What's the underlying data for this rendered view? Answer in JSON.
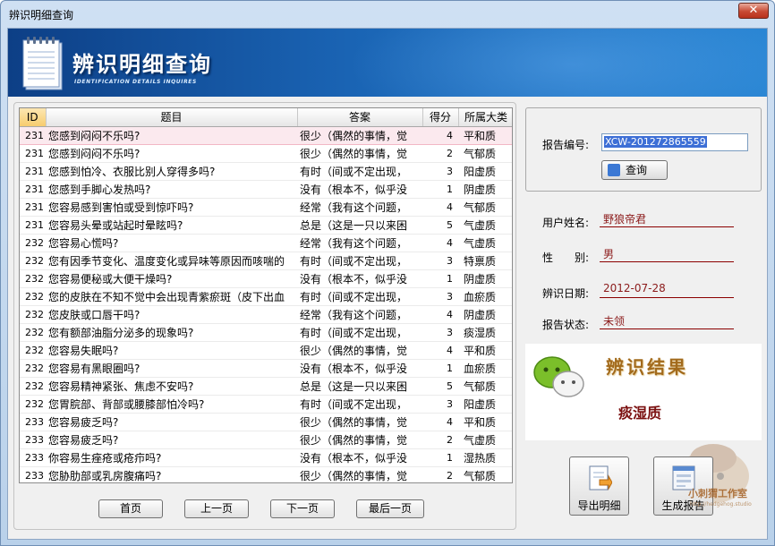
{
  "window": {
    "title": "辨识明细查询",
    "close_label": "✕"
  },
  "banner": {
    "title": "辨识明细查询",
    "subtitle": "IDENTIFICATION DETAILS INQUIRES"
  },
  "table": {
    "headers": {
      "id": "ID",
      "question": "题目",
      "answer": "答案",
      "score": "得分",
      "category": "所属大类"
    },
    "rows": [
      {
        "id": "231",
        "question": "您感到闷闷不乐吗?",
        "answer": "很少（偶然的事情，觉",
        "score": "4",
        "category": "平和质"
      },
      {
        "id": "231",
        "question": "您感到闷闷不乐吗?",
        "answer": "很少（偶然的事情，觉",
        "score": "2",
        "category": "气郁质"
      },
      {
        "id": "231",
        "question": "您感到怕冷、衣服比别人穿得多吗?",
        "answer": "有时（间或不定出现，",
        "score": "3",
        "category": "阳虚质"
      },
      {
        "id": "231",
        "question": "您感到手脚心发热吗?",
        "answer": "没有（根本不，似乎没",
        "score": "1",
        "category": "阴虚质"
      },
      {
        "id": "231",
        "question": "您容易感到害怕或受到惊吓吗?",
        "answer": "经常（我有这个问题，",
        "score": "4",
        "category": "气郁质"
      },
      {
        "id": "231",
        "question": "您容易头晕或站起时晕眩吗?",
        "answer": "总是（这是一只以来困",
        "score": "5",
        "category": "气虚质"
      },
      {
        "id": "232",
        "question": "您容易心慌吗?",
        "answer": "经常（我有这个问题，",
        "score": "4",
        "category": "气虚质"
      },
      {
        "id": "232",
        "question": "您有因季节变化、温度变化或异味等原因而咳喘的",
        "answer": "有时（间或不定出现，",
        "score": "3",
        "category": "特禀质"
      },
      {
        "id": "232",
        "question": "您容易便秘或大便干燥吗?",
        "answer": "没有（根本不，似乎没",
        "score": "1",
        "category": "阴虚质"
      },
      {
        "id": "232",
        "question": "您的皮肤在不知不觉中会出现青紫瘀斑（皮下出血",
        "answer": "有时（间或不定出现，",
        "score": "3",
        "category": "血瘀质"
      },
      {
        "id": "232",
        "question": "您皮肤或口唇干吗?",
        "answer": "经常（我有这个问题，",
        "score": "4",
        "category": "阴虚质"
      },
      {
        "id": "232",
        "question": "您有额部油脂分泌多的现象吗?",
        "answer": "有时（间或不定出现，",
        "score": "3",
        "category": "痰湿质"
      },
      {
        "id": "232",
        "question": "您容易失眠吗?",
        "answer": "很少（偶然的事情，觉",
        "score": "4",
        "category": "平和质"
      },
      {
        "id": "232",
        "question": "您容易有黑眼圈吗?",
        "answer": "没有（根本不，似乎没",
        "score": "1",
        "category": "血瘀质"
      },
      {
        "id": "232",
        "question": "您容易精神紧张、焦虑不安吗?",
        "answer": "总是（这是一只以来困",
        "score": "5",
        "category": "气郁质"
      },
      {
        "id": "232",
        "question": "您胃脘部、背部或腰膝部怕冷吗?",
        "answer": "有时（间或不定出现，",
        "score": "3",
        "category": "阳虚质"
      },
      {
        "id": "233",
        "question": "您容易疲乏吗?",
        "answer": "很少（偶然的事情，觉",
        "score": "4",
        "category": "平和质"
      },
      {
        "id": "233",
        "question": "您容易疲乏吗?",
        "answer": "很少（偶然的事情，觉",
        "score": "2",
        "category": "气虚质"
      },
      {
        "id": "233",
        "question": "你容易生痤疮或疮疖吗?",
        "answer": "没有（根本不，似乎没",
        "score": "1",
        "category": "湿热质"
      },
      {
        "id": "233",
        "question": "您胁肋部或乳房腹痛吗?",
        "answer": "很少（偶然的事情，觉",
        "score": "2",
        "category": "气郁质"
      }
    ]
  },
  "pager": {
    "first": "首页",
    "prev": "上一页",
    "next": "下一页",
    "last": "最后一页"
  },
  "report": {
    "id_label": "报告编号:",
    "id_value": "XCW-201272865559",
    "query_label": "查询",
    "user_label": "用户姓名:",
    "user_value": "野狼帝君",
    "gender_label": "性　　别:",
    "gender_value": "男",
    "date_label": "辨识日期:",
    "date_value": "2012-07-28",
    "status_label": "报告状态:",
    "status_value": "未领"
  },
  "result": {
    "title": "辨识结果",
    "value": "痰湿质"
  },
  "actions": {
    "export_label": "导出明细",
    "generate_label": "生成报告"
  },
  "watermark": {
    "text": "小刺猬工作室",
    "sub": "http://hedgehog.studio"
  }
}
